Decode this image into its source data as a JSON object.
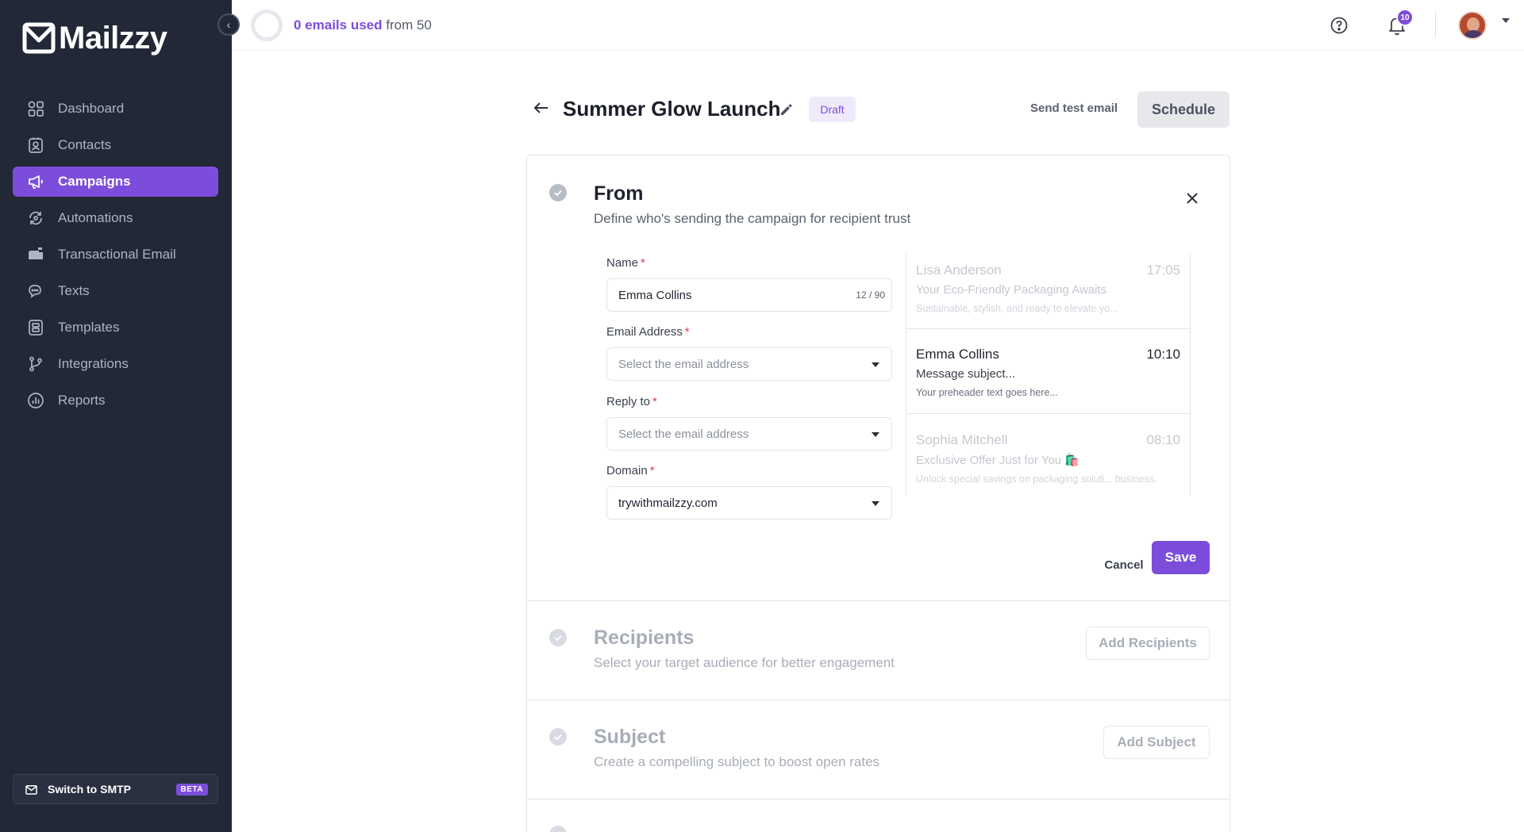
{
  "brand": {
    "name": "Mailzzy",
    "accent": "#7c4ddb",
    "sidebar_bg": "#222836"
  },
  "sidebar": {
    "items": [
      {
        "label": "Dashboard",
        "icon": "dashboard-icon"
      },
      {
        "label": "Contacts",
        "icon": "contacts-icon"
      },
      {
        "label": "Campaigns",
        "icon": "megaphone-icon",
        "active": true
      },
      {
        "label": "Automations",
        "icon": "automations-icon"
      },
      {
        "label": "Transactional Email",
        "icon": "mailbox-icon"
      },
      {
        "label": "Texts",
        "icon": "chat-icon"
      },
      {
        "label": "Templates",
        "icon": "templates-icon"
      },
      {
        "label": "Integrations",
        "icon": "branch-icon"
      },
      {
        "label": "Reports",
        "icon": "reports-icon"
      }
    ],
    "smtp_label": "Switch to SMTP",
    "smtp_badge": "BETA"
  },
  "topbar": {
    "usage_used": "0 emails used",
    "usage_from": " from 50",
    "notification_count": "10"
  },
  "campaign": {
    "title": "Summer Glow Launch",
    "status": "Draft",
    "send_test_label": "Send test email",
    "schedule_label": "Schedule"
  },
  "from_section": {
    "title": "From",
    "description": "Define who's sending the campaign for recipient trust",
    "name_label": "Name",
    "name_value": "Emma Collins",
    "name_count": "12 / 90",
    "email_label": "Email Address",
    "email_placeholder": "Select the email address",
    "reply_label": "Reply to",
    "reply_placeholder": "Select the email address",
    "domain_label": "Domain",
    "domain_value": "trywithmailzzy.com",
    "cancel_label": "Cancel",
    "save_label": "Save"
  },
  "inbox_preview": [
    {
      "sender": "Lisa Anderson",
      "time": "17:05",
      "subject": "Your Eco-Friendly Packaging Awaits",
      "preheader": "Sustainable, stylish, and ready to elevate yo..."
    },
    {
      "sender": "Emma Collins",
      "time": "10:10",
      "subject": "Message subject...",
      "preheader": "Your preheader text goes here..."
    },
    {
      "sender": "Sophia Mitchell",
      "time": "08:10",
      "subject": "Exclusive Offer Just for You 🛍️",
      "preheader": "Unlock special savings on packaging soluti... business."
    }
  ],
  "recipients_section": {
    "title": "Recipients",
    "description": "Select your target audience for better engagement",
    "button_label": "Add Recipients"
  },
  "subject_section": {
    "title": "Subject",
    "description": "Create a compelling subject to boost open rates",
    "button_label": "Add Subject"
  }
}
